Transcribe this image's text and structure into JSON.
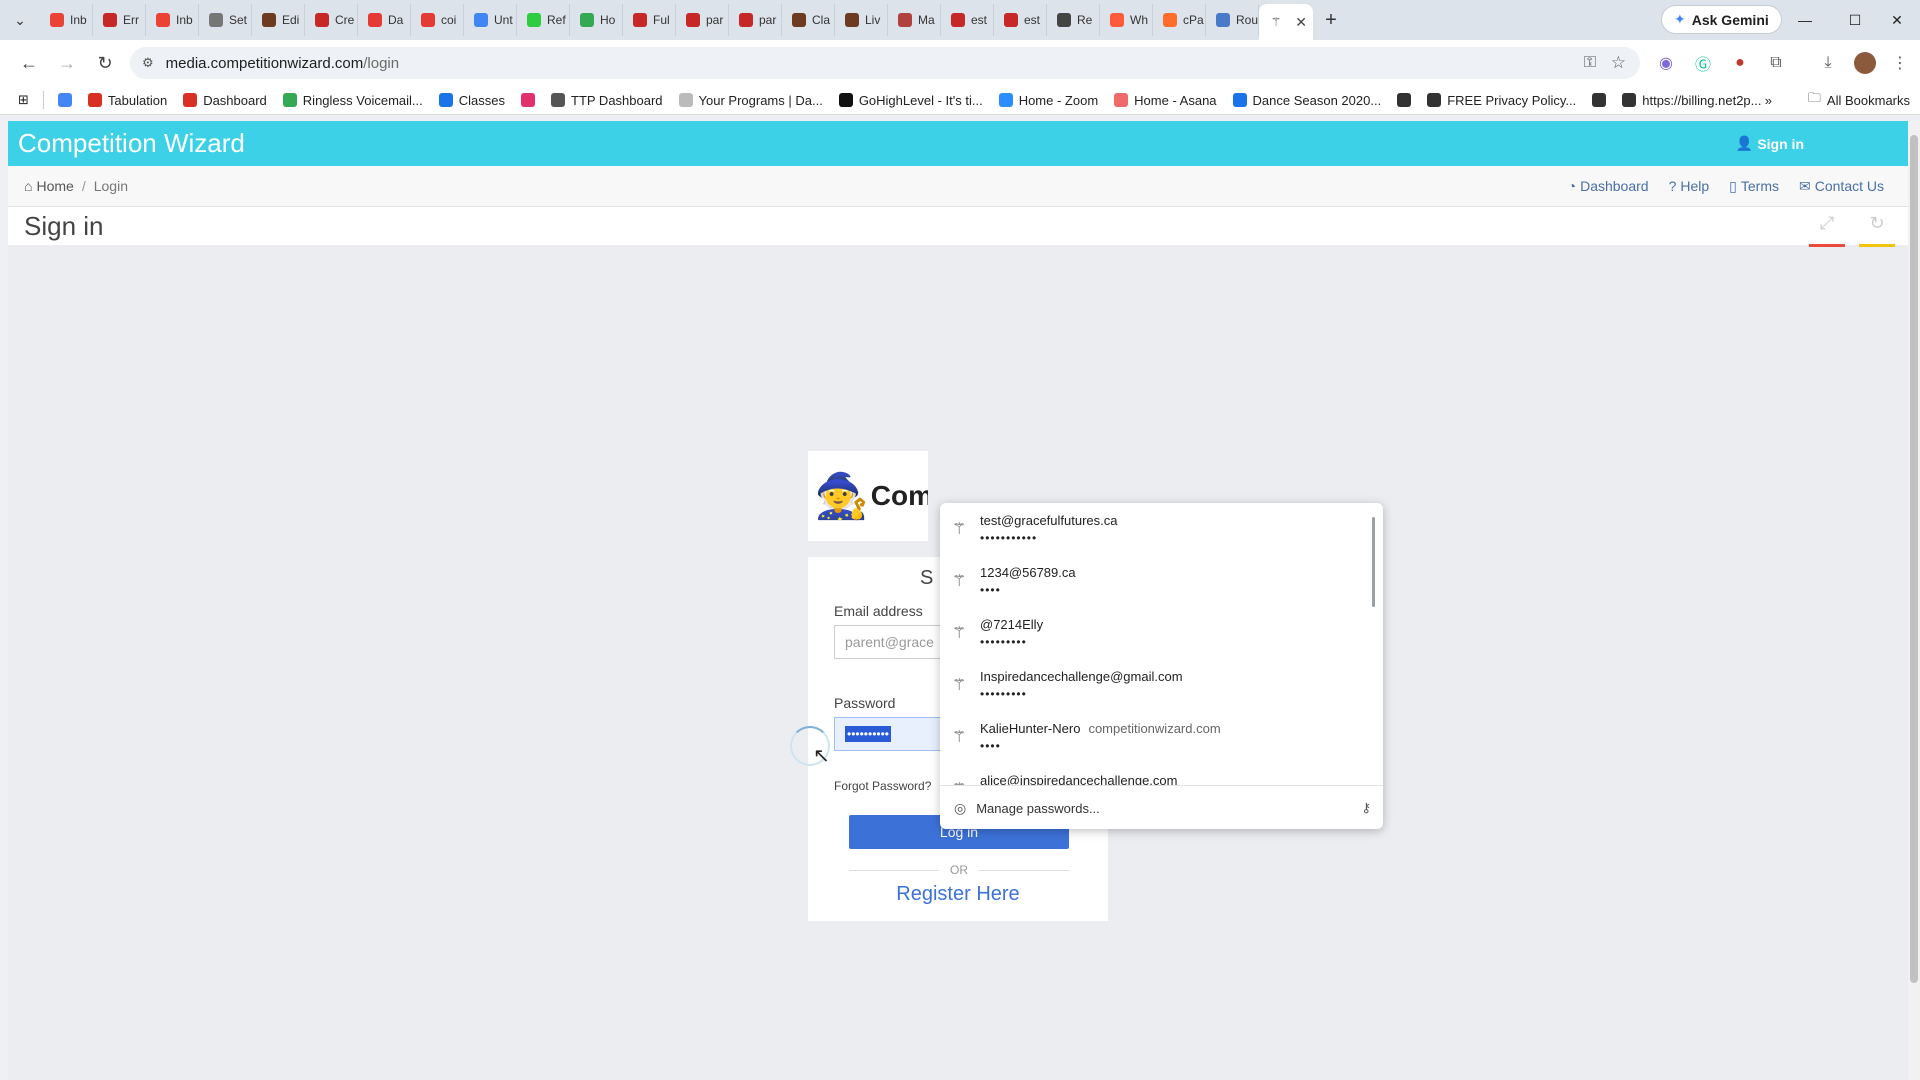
{
  "browser": {
    "tabs": [
      {
        "label": "Inb",
        "color": "#ea4335"
      },
      {
        "label": "Err",
        "color": "#c62828"
      },
      {
        "label": "Inb",
        "color": "#ea4335"
      },
      {
        "label": "Set",
        "color": "#777777"
      },
      {
        "label": "Edi",
        "color": "#6d3b1f"
      },
      {
        "label": "Cre",
        "color": "#c62828"
      },
      {
        "label": "Da",
        "color": "#e53935"
      },
      {
        "label": "coi",
        "color": "#e53935"
      },
      {
        "label": "Unt",
        "color": "#4285f4"
      },
      {
        "label": "Ref",
        "color": "#2ecc40"
      },
      {
        "label": "Ho",
        "color": "#34a853"
      },
      {
        "label": "Ful",
        "color": "#c62828"
      },
      {
        "label": "par",
        "color": "#c62828"
      },
      {
        "label": "par",
        "color": "#c62828"
      },
      {
        "label": "Cla",
        "color": "#6d3b1f"
      },
      {
        "label": "Liv",
        "color": "#6d3b1f"
      },
      {
        "label": "Ma",
        "color": "#b0413e"
      },
      {
        "label": "est",
        "color": "#c62828"
      },
      {
        "label": "est",
        "color": "#c62828"
      },
      {
        "label": "Re",
        "color": "#444444"
      },
      {
        "label": "Wh",
        "color": "#ff5a3c"
      },
      {
        "label": "cPa",
        "color": "#ff6c2c"
      },
      {
        "label": "Rou",
        "color": "#4a79c7"
      }
    ],
    "ask_gemini": "Ask Gemini",
    "url_host": "media.competitionwizard.com",
    "url_path": "/login",
    "bookmarks": [
      "Tabulation",
      "Dashboard",
      "Ringless Voicemail...",
      "Classes",
      "",
      "TTP Dashboard",
      "Your Programs | Da...",
      "GoHighLevel - It's ti...",
      "Home - Zoom",
      "Home - Asana",
      "Dance Season 2020...",
      "",
      "FREE Privacy Policy...",
      "",
      "https://billing.net2p..."
    ],
    "bookmark_colors": [
      "#d93025",
      "#d93025",
      "#34a853",
      "#1a73e8",
      "#e1306c",
      "#555555",
      "#bbbbbb",
      "#111111",
      "#2d8cff",
      "#f06a6a",
      "#1a73e8",
      "#333333",
      "#333333",
      "#333333",
      "#333333"
    ],
    "all_bookmarks": "All Bookmarks",
    "more": "»"
  },
  "site": {
    "brand": "Competition Wizard",
    "top_signin": "Sign in",
    "breadcrumb_home": "Home",
    "breadcrumb_current": "Login",
    "links": [
      "Dashboard",
      "Help",
      "Terms",
      "Contact Us"
    ],
    "page_title": "Sign in",
    "accent_colors": {
      "red": "#e74c3c",
      "yellow": "#f1c40f",
      "bar": "#3dd1e8",
      "button": "#3c72d8"
    }
  },
  "login": {
    "logo_text": "Com",
    "heading": "S",
    "email_label": "Email address",
    "email_placeholder": "parent@grace",
    "password_label": "Password",
    "password_value": "••••••••••",
    "forgot": "Forgot Password?",
    "login_button": "Log in",
    "or": "OR",
    "register": "Register Here"
  },
  "password_dropdown": {
    "items": [
      {
        "user": "test@gracefulfutures.ca",
        "site": "",
        "dots": "•••••••••••"
      },
      {
        "user": "1234@56789.ca",
        "site": "",
        "dots": "••••"
      },
      {
        "user": "@7214Elly",
        "site": "",
        "dots": "•••••••••"
      },
      {
        "user": "Inspiredancechallenge@gmail.com",
        "site": "",
        "dots": "•••••••••"
      },
      {
        "user": "KalieHunter-Nero",
        "site": "competitionwizard.com",
        "dots": "••••"
      },
      {
        "user": "alice@inspiredancechallenge.com",
        "site": "",
        "dots": ""
      }
    ],
    "manage": "Manage passwords..."
  }
}
